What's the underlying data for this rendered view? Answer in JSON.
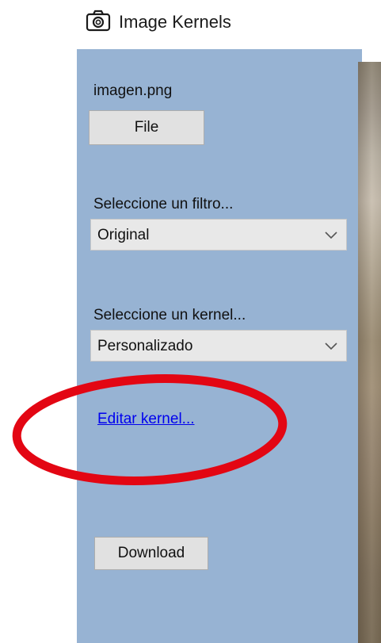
{
  "window": {
    "title": "Image Kernels",
    "icon": "camera-icon"
  },
  "panel": {
    "file_name": "imagen.png",
    "file_button_label": "File",
    "filter_label": "Seleccione un filtro...",
    "filter_value": "Original",
    "kernel_label": "Seleccione un kernel...",
    "kernel_value": "Personalizado",
    "edit_kernel_link": "Editar kernel...",
    "download_button_label": "Download"
  },
  "colors": {
    "panel_background": "#97b3d3",
    "annotation_ellipse": "#e30613",
    "link": "#0000ee"
  }
}
